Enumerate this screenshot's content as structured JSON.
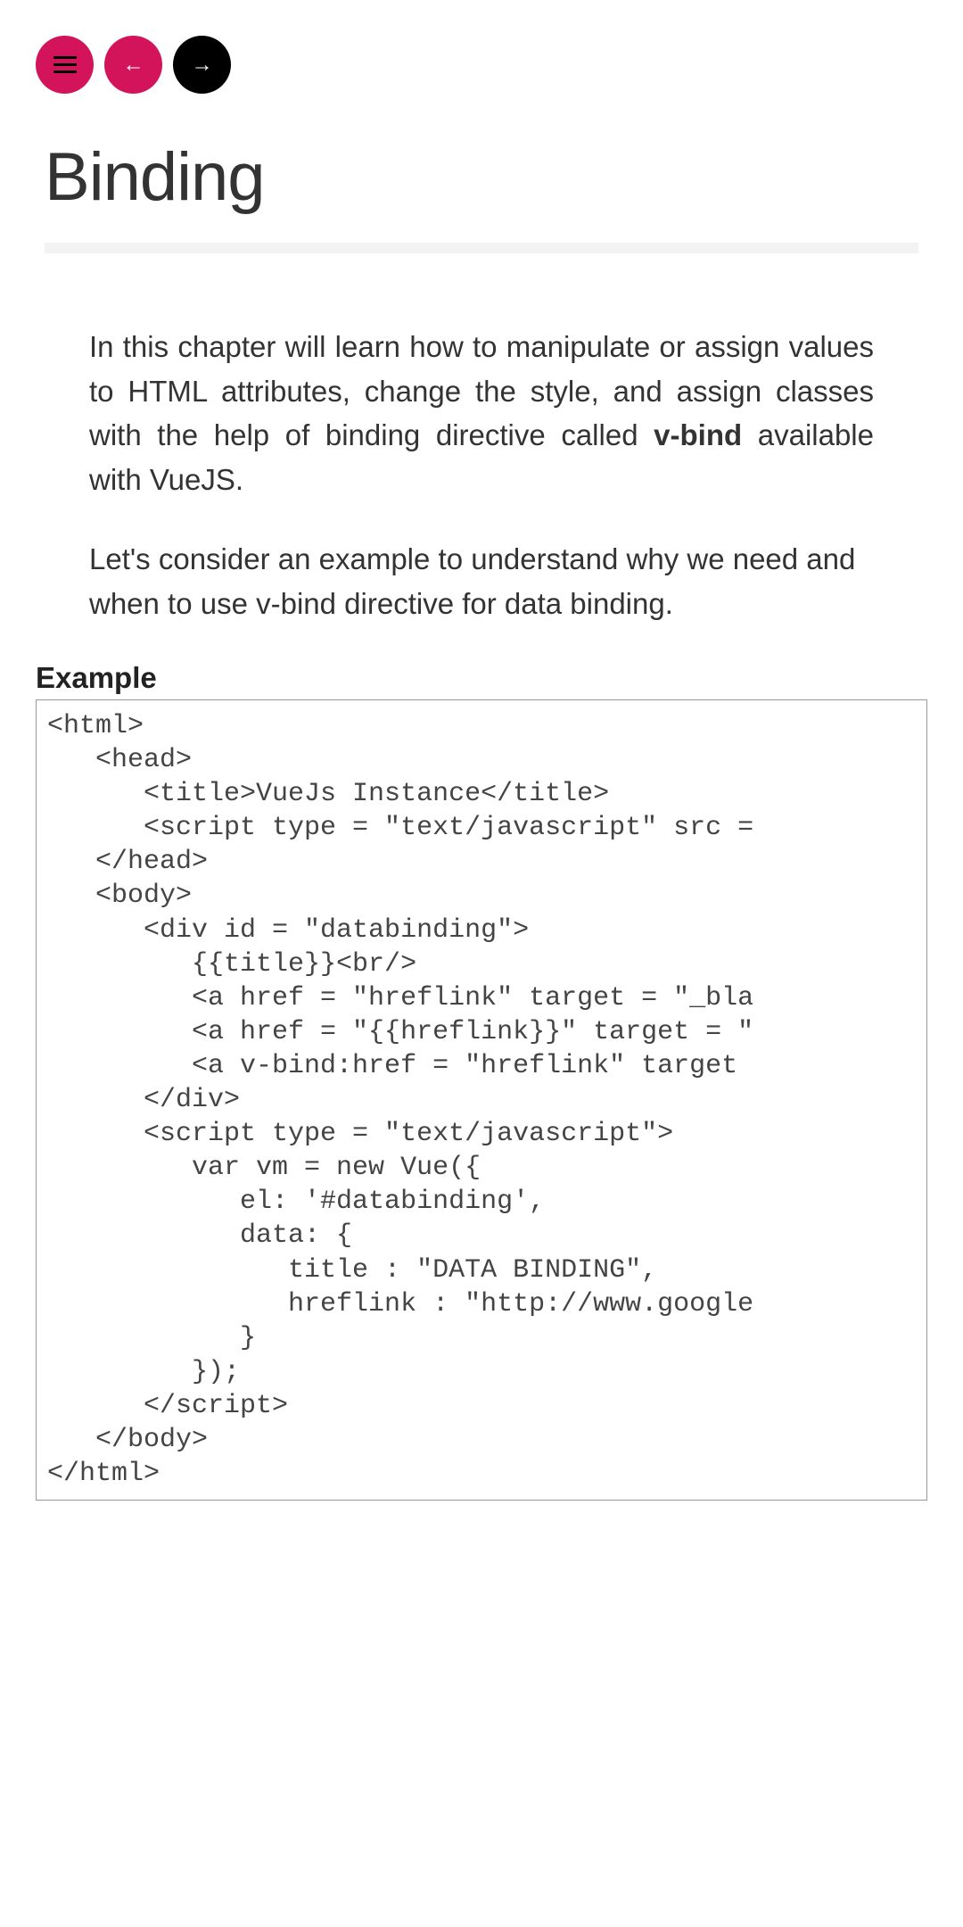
{
  "nav": {
    "prev_arrow": "←",
    "next_arrow": "→"
  },
  "page": {
    "title": "Binding"
  },
  "content": {
    "p1_pre": "In this chapter will learn how to manipulate or assign values to HTML attributes, change the style, and assign classes with the help of binding directive called ",
    "p1_bold": "v-bind",
    "p1_post": " available with VueJS.",
    "p2": "Let's consider an example to understand why we need and when to use v-bind directive for data binding.",
    "example_label": "Example",
    "code": "<html>\n   <head>\n      <title>VueJs Instance</title>\n      <script type = \"text/javascript\" src =\n   </head>\n   <body>\n      <div id = \"databinding\">\n         {{title}}<br/>\n         <a href = \"hreflink\" target = \"_bla\n         <a href = \"{{hreflink}}\" target = \"\n         <a v-bind:href = \"hreflink\" target \n      </div>\n      <script type = \"text/javascript\">\n         var vm = new Vue({\n            el: '#databinding',\n            data: {\n               title : \"DATA BINDING\",\n               hreflink : \"http://www.google\n            }\n         });\n      </scr ipt>\n   </body>\n</html>"
  }
}
